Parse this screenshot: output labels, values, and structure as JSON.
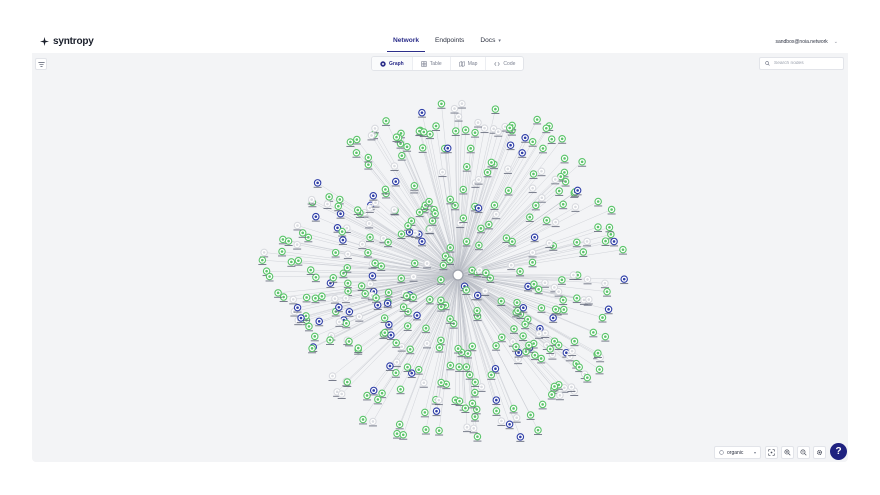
{
  "brand": {
    "name": "syntropy"
  },
  "nav": {
    "items": [
      {
        "label": "Network",
        "active": true
      },
      {
        "label": "Endpoints",
        "active": false
      },
      {
        "label": "Docs",
        "active": false,
        "dropdown": true
      }
    ]
  },
  "user": {
    "email": "sandbox@noia.network"
  },
  "view_tabs": [
    {
      "label": "Graph",
      "icon": "graph-icon",
      "active": true
    },
    {
      "label": "Table",
      "icon": "table-icon",
      "active": false
    },
    {
      "label": "Map",
      "icon": "map-icon",
      "active": false
    },
    {
      "label": "Code",
      "icon": "code-icon",
      "active": false
    }
  ],
  "search": {
    "placeholder": "Search nodes",
    "value": ""
  },
  "layout_select": {
    "value": "organic"
  },
  "help": {
    "label": "?"
  },
  "colors": {
    "accent": "#2c2e8a",
    "help_bg": "#1f2280",
    "canvas_bg": "#f3f4f6",
    "node_green": "#5bc46a",
    "node_grey": "#d9dbe0",
    "node_blue": "#2f3fa8"
  }
}
